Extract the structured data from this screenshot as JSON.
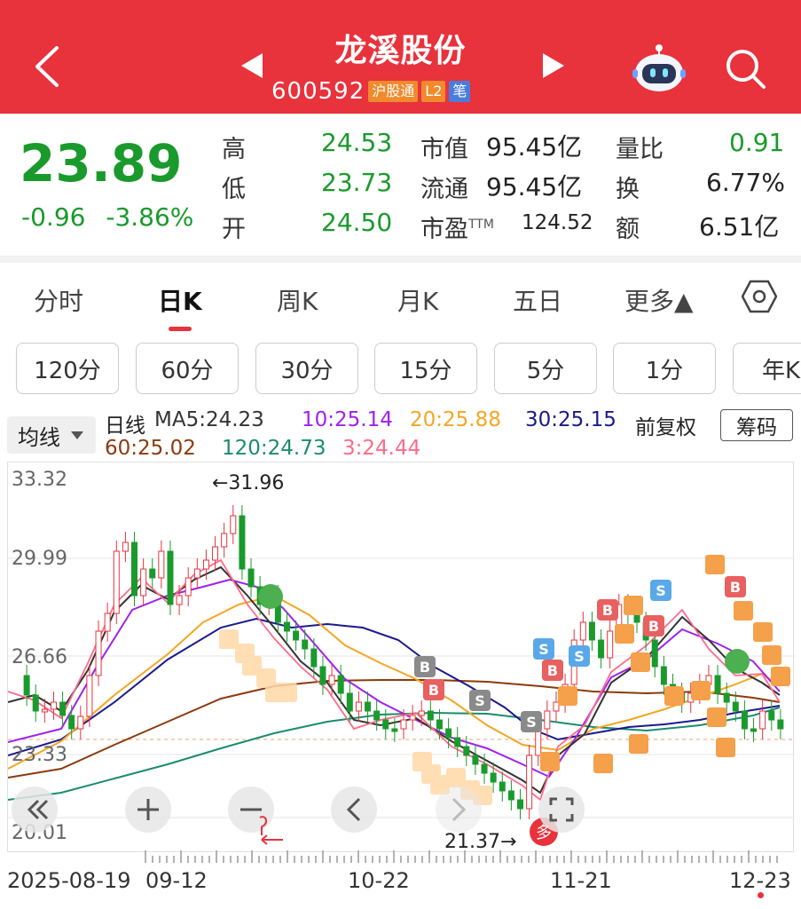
{
  "header": {
    "title": "龙溪股份",
    "code": "600592",
    "tags": [
      "沪股通",
      "L2",
      "笔"
    ]
  },
  "quote": {
    "price": "23.89",
    "change": "-0.96",
    "change_pct": "-3.86%",
    "rows": [
      {
        "l1": "高",
        "v1": "24.53",
        "l2": "市值",
        "v2": "95.45亿",
        "l3": "量比",
        "v3": "0.91"
      },
      {
        "l1": "低",
        "v1": "23.73",
        "l2": "流通",
        "v2": "95.45亿",
        "l3": "换",
        "v3": "6.77%"
      },
      {
        "l1": "开",
        "v1": "24.50",
        "l2": "市盈",
        "l2sup": "TTM",
        "v2": "124.52",
        "l3": "额",
        "v3": "6.51亿"
      }
    ]
  },
  "tabs": [
    "分时",
    "日K",
    "周K",
    "月K",
    "五日",
    "更多▲"
  ],
  "active_tab": "日K",
  "periods": [
    "120分",
    "60分",
    "30分",
    "15分",
    "5分",
    "1分",
    "年K"
  ],
  "legend": {
    "avg_button": "均线",
    "kline": "日线",
    "ma5": "MA5:24.23",
    "ma10": "10:25.14",
    "ma20": "20:25.88",
    "ma30": "30:25.15",
    "adjust": "前复权",
    "chip": "筹码",
    "ma60": "60:25.02",
    "ma120": "120:24.73",
    "ma3": "3:24.44"
  },
  "colors": {
    "up": "#e8323c",
    "down": "#1a9a2c",
    "ma5": "#333333",
    "ma10": "#a020f0",
    "ma20": "#f5a623",
    "ma30": "#1a1a8c",
    "ma60": "#8b3a0e",
    "ma120": "#1a8c6e",
    "ma3": "#ff6b8a"
  },
  "chart": {
    "y_ticks": [
      "33.32",
      "29.99",
      "26.66",
      "23.33",
      "20.01"
    ],
    "high_note": "←31.96",
    "low_note": "21.37→",
    "duo_badge": "多",
    "dates": [
      "2025-08-19",
      "09-12",
      "10-22",
      "11-21",
      "12-23"
    ]
  }
}
